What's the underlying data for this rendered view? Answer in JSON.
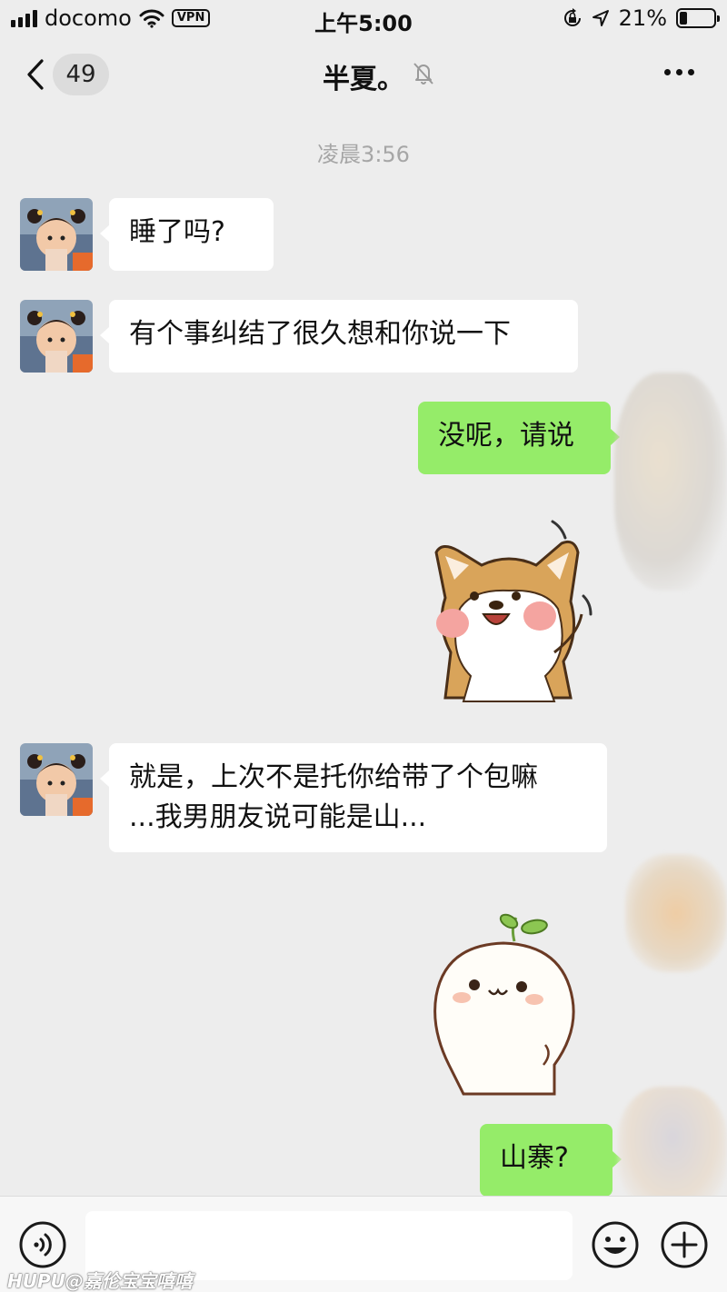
{
  "status_bar": {
    "carrier": "docomo",
    "vpn": "VPN",
    "time": "上午5:00",
    "battery": "21%",
    "battery_level": 0.21
  },
  "header": {
    "back_count": "49",
    "title": "半夏。"
  },
  "timestamp": "凌晨3:56",
  "messages": {
    "m1": {
      "text": "睡了吗?"
    },
    "m2": {
      "text": "有个事纠结了很久想和你说一下"
    },
    "m3": {
      "text": "没呢，请说"
    },
    "m5": {
      "lines": [
        "就是，上次不是托你给带了个包嘛",
        "...我男朋友说可能是山..."
      ]
    },
    "m7": {
      "text": "山寨?"
    }
  },
  "stickers": {
    "s1": "shiba-dog-wave-sticker",
    "s2": "sprout-bun-sticker"
  },
  "input": {
    "placeholder": ""
  },
  "watermark": {
    "brand": "HUPU",
    "text": "@嘉伦宝宝嘻嘻"
  },
  "colors": {
    "background": "#ededed",
    "incoming_bubble": "#ffffff",
    "outgoing_bubble": "#95ec69"
  }
}
